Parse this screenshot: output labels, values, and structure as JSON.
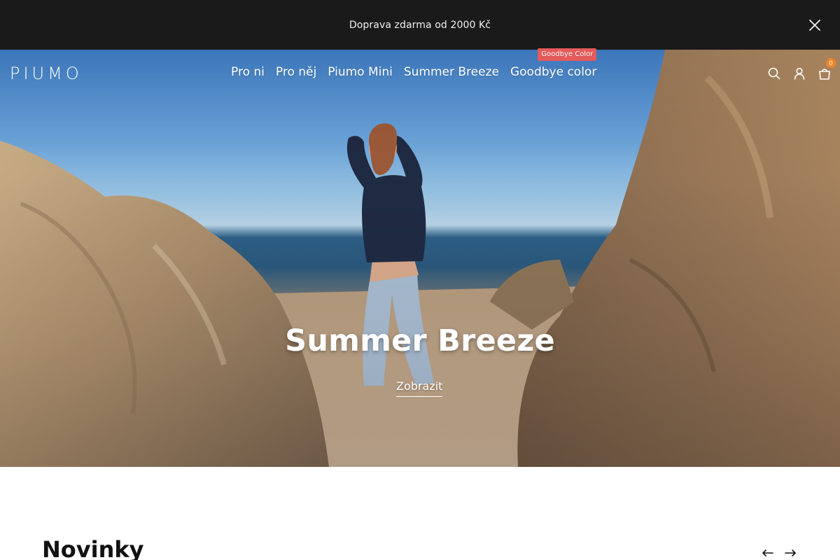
{
  "announcement": {
    "text": "Doprava zdarma od 2000 Kč"
  },
  "header": {
    "logo": "PIUMO",
    "nav": [
      {
        "label": "Pro ni"
      },
      {
        "label": "Pro něj"
      },
      {
        "label": "Piumo Mini"
      },
      {
        "label": "Summer Breeze"
      },
      {
        "label": "Goodbye color",
        "badge": "Goodbye Color"
      }
    ],
    "icons": [
      "search-icon",
      "account-icon",
      "cart-icon"
    ],
    "cart_count": "0"
  },
  "hero": {
    "title": "Summer Breeze",
    "link": "Zobrazit"
  },
  "section": {
    "title": "Novinky",
    "arrows": [
      "arrow-left-icon",
      "arrow-right-icon"
    ]
  },
  "colors": {
    "announcement_bg": "#1a1a1a",
    "badge": "#e55a5a",
    "cart_badge": "#f0852c",
    "text": "#111111"
  }
}
